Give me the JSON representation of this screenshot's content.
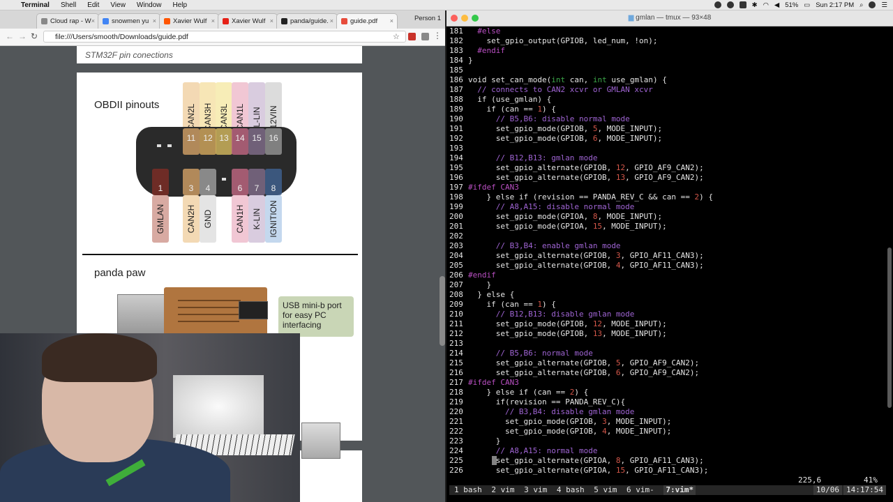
{
  "menubar": {
    "app": "Terminal",
    "items": [
      "Shell",
      "Edit",
      "View",
      "Window",
      "Help"
    ],
    "battery": "51%",
    "clock": "Sun 2:17 PM"
  },
  "browser": {
    "tabs": [
      {
        "label": "Cloud rap - W",
        "color": "#888888"
      },
      {
        "label": "snowmen yu",
        "color": "#4285f4"
      },
      {
        "label": "Xavier Wulf",
        "color": "#ff5500"
      },
      {
        "label": "Xavier Wulf",
        "color": "#e62117"
      },
      {
        "label": "panda/guide.",
        "color": "#222222"
      },
      {
        "label": "guide.pdf",
        "color": "#e74c3c"
      }
    ],
    "person": "Person 1",
    "url": "file:///Users/smooth/Downloads/guide.pdf"
  },
  "pdf": {
    "caption": "STM32F pin conections",
    "obd_title": "OBDII pinouts",
    "top_labels": [
      {
        "text": "CAN2L",
        "color": "#f3d9b4"
      },
      {
        "text": "CAN3H",
        "color": "#f7e6b6"
      },
      {
        "text": "CAN3L",
        "color": "#f7edb7"
      },
      {
        "text": "CAN1L",
        "color": "#f1c7d4"
      },
      {
        "text": "L-LIN",
        "color": "#d9ccdf"
      },
      {
        "text": "12VIN",
        "color": "#dcdcdc"
      }
    ],
    "top_pins": [
      "11",
      "12",
      "13",
      "14",
      "15",
      "16"
    ],
    "bottom_pins": [
      "1",
      "3",
      "4",
      "6",
      "7",
      "8"
    ],
    "bottom_labels": [
      {
        "text": "GMLAN",
        "color": "#d8aaa2"
      },
      {
        "text": "CAN2H",
        "color": "#f3d9b4"
      },
      {
        "text": "GND",
        "color": "#e4e4e4"
      },
      {
        "text": "CAN1H",
        "color": "#f1c7d4"
      },
      {
        "text": "K-LIN",
        "color": "#d9ccdf"
      },
      {
        "text": "IGNITION",
        "color": "#c4d8ee"
      }
    ],
    "paw_title": "panda paw",
    "usb_note": "USB mini-b port for easy PC interfacing"
  },
  "terminal": {
    "title": "gmlan — tmux — 93×48",
    "vim_pos": "225,6",
    "vim_pct": "41%",
    "tmux_windows": [
      "1 bash",
      "2 vim",
      "3 vim",
      "4 bash",
      "5 vim",
      "6 vim-",
      "7:vim*"
    ],
    "tmux_date": "10/06",
    "tmux_time": "14:17:54"
  },
  "code_lines": [
    {
      "n": "181",
      "t": "  #else",
      "k": "pp"
    },
    {
      "n": "182",
      "t": "    set_gpio_output(GPIOB, led_num, !on);",
      "k": ""
    },
    {
      "n": "183",
      "t": "  #endif",
      "k": "pp"
    },
    {
      "n": "184",
      "t": "}",
      "k": ""
    },
    {
      "n": "185",
      "t": "",
      "k": ""
    },
    {
      "n": "186",
      "t": "void set_can_mode(int can, int use_gmlan) {",
      "k": "fn"
    },
    {
      "n": "187",
      "t": "  // connects to CAN2 xcvr or GMLAN xcvr",
      "k": "cmt"
    },
    {
      "n": "188",
      "t": "  if (use_gmlan) {",
      "k": ""
    },
    {
      "n": "189",
      "t": "    if (can == 1) {",
      "k": "num"
    },
    {
      "n": "190",
      "t": "      // B5,B6: disable normal mode",
      "k": "cmt"
    },
    {
      "n": "191",
      "t": "      set_gpio_mode(GPIOB, 5, MODE_INPUT);",
      "k": "num"
    },
    {
      "n": "192",
      "t": "      set_gpio_mode(GPIOB, 6, MODE_INPUT);",
      "k": "num"
    },
    {
      "n": "193",
      "t": "",
      "k": ""
    },
    {
      "n": "194",
      "t": "      // B12,B13: gmlan mode",
      "k": "cmt"
    },
    {
      "n": "195",
      "t": "      set_gpio_alternate(GPIOB, 12, GPIO_AF9_CAN2);",
      "k": "num"
    },
    {
      "n": "196",
      "t": "      set_gpio_alternate(GPIOB, 13, GPIO_AF9_CAN2);",
      "k": "num"
    },
    {
      "n": "197",
      "t": "#ifdef CAN3",
      "k": "pp"
    },
    {
      "n": "198",
      "t": "    } else if (revision == PANDA_REV_C && can == 2) {",
      "k": "num"
    },
    {
      "n": "199",
      "t": "      // A8,A15: disable normal mode",
      "k": "cmt"
    },
    {
      "n": "200",
      "t": "      set_gpio_mode(GPIOA, 8, MODE_INPUT);",
      "k": "num"
    },
    {
      "n": "201",
      "t": "      set_gpio_mode(GPIOA, 15, MODE_INPUT);",
      "k": "num"
    },
    {
      "n": "202",
      "t": "",
      "k": ""
    },
    {
      "n": "203",
      "t": "      // B3,B4: enable gmlan mode",
      "k": "cmt"
    },
    {
      "n": "204",
      "t": "      set_gpio_alternate(GPIOB, 3, GPIO_AF11_CAN3);",
      "k": "num"
    },
    {
      "n": "205",
      "t": "      set_gpio_alternate(GPIOB, 4, GPIO_AF11_CAN3);",
      "k": "num"
    },
    {
      "n": "206",
      "t": "#endif",
      "k": "pp"
    },
    {
      "n": "207",
      "t": "    }",
      "k": ""
    },
    {
      "n": "208",
      "t": "  } else {",
      "k": ""
    },
    {
      "n": "209",
      "t": "    if (can == 1) {",
      "k": "num"
    },
    {
      "n": "210",
      "t": "      // B12,B13: disable gmlan mode",
      "k": "cmt"
    },
    {
      "n": "211",
      "t": "      set_gpio_mode(GPIOB, 12, MODE_INPUT);",
      "k": "num"
    },
    {
      "n": "212",
      "t": "      set_gpio_mode(GPIOB, 13, MODE_INPUT);",
      "k": "num"
    },
    {
      "n": "213",
      "t": "",
      "k": ""
    },
    {
      "n": "214",
      "t": "      // B5,B6: normal mode",
      "k": "cmt"
    },
    {
      "n": "215",
      "t": "      set_gpio_alternate(GPIOB, 5, GPIO_AF9_CAN2);",
      "k": "num"
    },
    {
      "n": "216",
      "t": "      set_gpio_alternate(GPIOB, 6, GPIO_AF9_CAN2);",
      "k": "num"
    },
    {
      "n": "217",
      "t": "#ifdef CAN3",
      "k": "pp"
    },
    {
      "n": "218",
      "t": "    } else if (can == 2) {",
      "k": "num"
    },
    {
      "n": "219",
      "t": "      if(revision == PANDA_REV_C){",
      "k": ""
    },
    {
      "n": "220",
      "t": "        // B3,B4: disable gmlan mode",
      "k": "cmt"
    },
    {
      "n": "221",
      "t": "        set_gpio_mode(GPIOB, 3, MODE_INPUT);",
      "k": "num"
    },
    {
      "n": "222",
      "t": "        set_gpio_mode(GPIOB, 4, MODE_INPUT);",
      "k": "num"
    },
    {
      "n": "223",
      "t": "      }",
      "k": ""
    },
    {
      "n": "224",
      "t": "      // A8,A15: normal mode",
      "k": "cmt"
    },
    {
      "n": "225",
      "t": "      set_gpio_alternate(GPIOA, 8, GPIO_AF11_CAN3);",
      "k": "num"
    },
    {
      "n": "226",
      "t": "      set_gpio_alternate(GPIOA, 15, GPIO_AF11_CAN3);",
      "k": "num"
    }
  ]
}
